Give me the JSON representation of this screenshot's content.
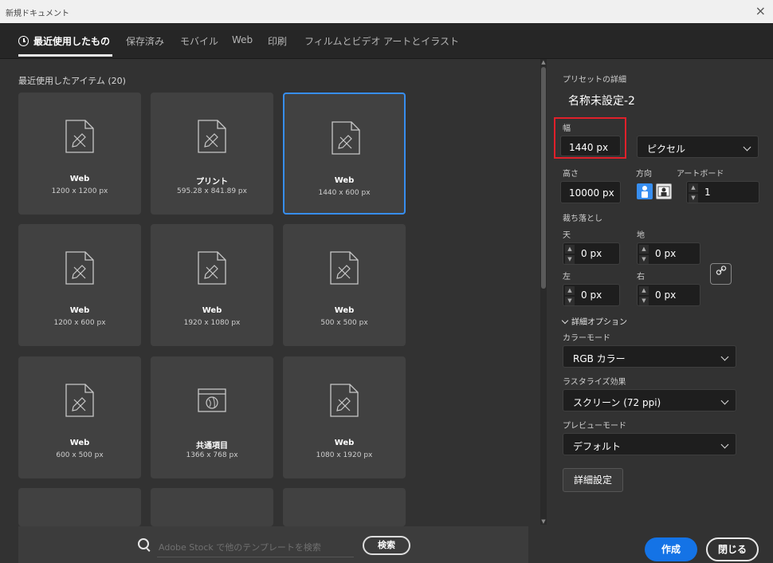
{
  "window": {
    "title": "新規ドキュメント",
    "close_glyph": "×"
  },
  "tabs": [
    {
      "label": "最近使用したもの",
      "active": true
    },
    {
      "label": "保存済み"
    },
    {
      "label": "モバイル"
    },
    {
      "label": "Web"
    },
    {
      "label": "印刷"
    },
    {
      "label": "フィルムとビデオ"
    },
    {
      "label": "アートとイラスト"
    }
  ],
  "recent": {
    "title": "最近使用したアイテム (20)",
    "items": [
      {
        "name": "Web",
        "size": "1200 x 1200 px",
        "icon": "document-pen-icon"
      },
      {
        "name": "プリント",
        "size": "595.28 x 841.89 px",
        "icon": "document-pen-icon"
      },
      {
        "name": "Web",
        "size": "1440 x 600 px",
        "icon": "document-pen-icon",
        "selected": true
      },
      {
        "name": "Web",
        "size": "1200 x 600 px",
        "icon": "document-pen-icon"
      },
      {
        "name": "Web",
        "size": "1920 x 1080 px",
        "icon": "document-pen-icon"
      },
      {
        "name": "Web",
        "size": "500 x 500 px",
        "icon": "document-pen-icon"
      },
      {
        "name": "Web",
        "size": "600 x 500 px",
        "icon": "document-pen-icon"
      },
      {
        "name": "共通項目",
        "size": "1366 x 768 px",
        "icon": "web-window-icon"
      },
      {
        "name": "Web",
        "size": "1080 x 1920 px",
        "icon": "document-pen-icon"
      }
    ]
  },
  "search": {
    "placeholder": "Adobe Stock で他のテンプレートを検索",
    "button": "検索"
  },
  "preset": {
    "title": "プリセットの詳細",
    "doc_name": "名称未設定-2",
    "width_label": "幅",
    "width_value": "1440 px",
    "unit": "ピクセル",
    "height_label": "高さ",
    "height_value": "10000 px",
    "orientation_label": "方向",
    "orientation": "portrait",
    "artboard_label": "アートボード",
    "artboard_value": "1",
    "bleed_label": "裁ち落とし",
    "top_label": "天",
    "top_value": "0 px",
    "bottom_label": "地",
    "bottom_value": "0 px",
    "left_label": "左",
    "left_value": "0 px",
    "right_label": "右",
    "right_value": "0 px",
    "advanced_label": "詳細オプション",
    "color_mode_label": "カラーモード",
    "color_mode": "RGB カラー",
    "raster_label": "ラスタライズ効果",
    "raster_value": "スクリーン (72 ppi)",
    "preview_label": "プレビューモード",
    "preview_value": "デフォルト",
    "more_settings": "詳細設定",
    "create": "作成",
    "close": "閉じる"
  },
  "colors": {
    "accent": "#1473e6",
    "highlight": "#e0202a",
    "selected_border": "#378ef0"
  }
}
